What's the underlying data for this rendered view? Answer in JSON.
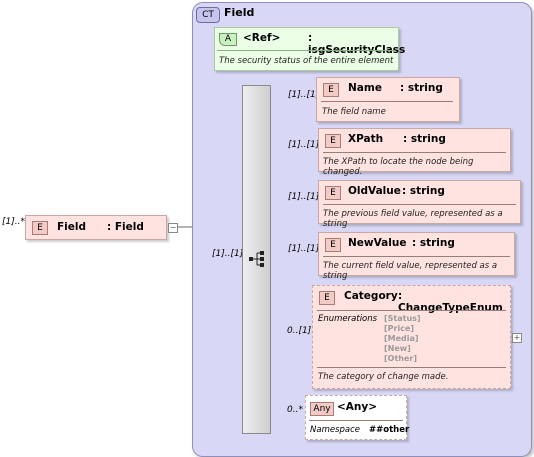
{
  "root": {
    "badge": "E",
    "name": "Field",
    "type": ": Field",
    "multiplicity": "[1]..*",
    "collapse_symbol": "−"
  },
  "complex_type": {
    "badge": "CT",
    "name": "Field"
  },
  "sequence": {
    "multiplicity": "[1]..[1]"
  },
  "attribute": {
    "badge": "A",
    "name": "<Ref>",
    "type": ": isgSecurityClass",
    "doc": "The security status of the entire element"
  },
  "children": [
    {
      "badge": "E",
      "name": "Name",
      "type": ": string",
      "multiplicity": "[1]..[1]",
      "doc": "The field name"
    },
    {
      "badge": "E",
      "name": "XPath",
      "type": ": string",
      "multiplicity": "[1]..[1]",
      "doc": "The XPath to locate the node being changed."
    },
    {
      "badge": "E",
      "name": "OldValue",
      "type": ": string",
      "multiplicity": "[1]..[1]",
      "doc": "The previous field value, represented as a string"
    },
    {
      "badge": "E",
      "name": "NewValue",
      "type": ": string",
      "multiplicity": "[1]..[1]",
      "doc": "The current field value, represented as a string"
    }
  ],
  "category": {
    "badge": "E",
    "name": "Category",
    "type": ": ChangeTypeEnum",
    "multiplicity": "0..[1]",
    "enum_label": "Enumerations",
    "enum_values": [
      "[Status]",
      "[Price]",
      "[Media]",
      "[New]",
      "[Other]"
    ],
    "doc": "The category of change made.",
    "expand_symbol": "+"
  },
  "any": {
    "badge": "Any",
    "name": "<Any>",
    "multiplicity": "0..*",
    "ns_label": "Namespace",
    "ns_value": "##other"
  }
}
